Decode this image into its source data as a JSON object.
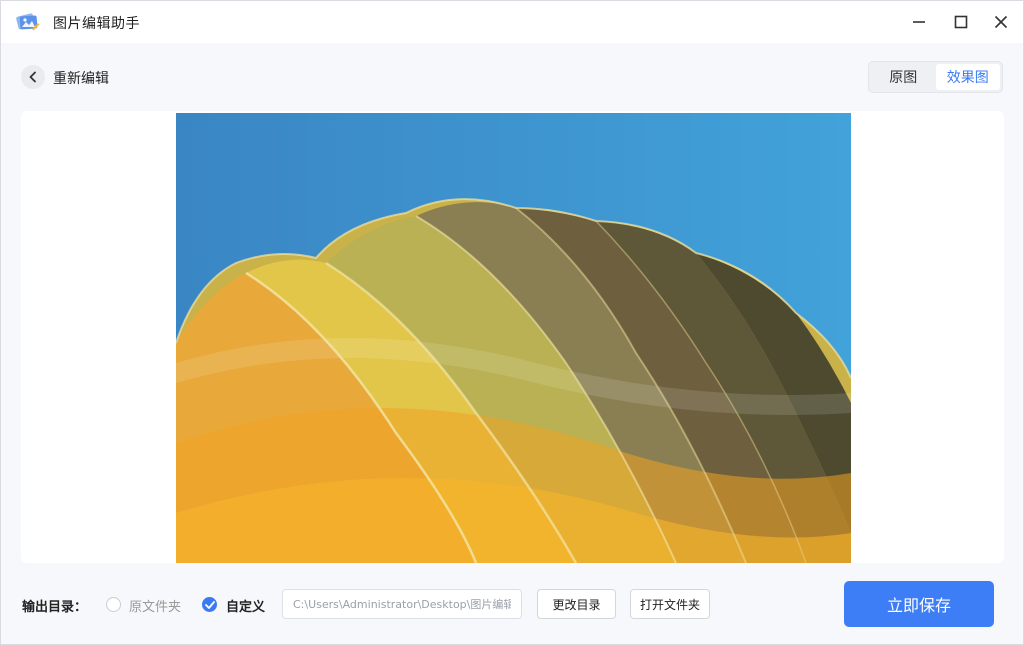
{
  "app": {
    "title": "图片编辑助手",
    "logo_icon": "photo-stack-icon",
    "window_controls": [
      "minimize-icon",
      "maximize-icon",
      "close-icon"
    ]
  },
  "toolbar": {
    "back_label": "重新编辑",
    "view_tabs": [
      {
        "label": "原图",
        "active": false
      },
      {
        "label": "效果图",
        "active": true
      }
    ]
  },
  "preview": {
    "image_subject": "hot-air-balloon-photo"
  },
  "output": {
    "label": "输出目录：",
    "option_original": "原文件夹",
    "option_custom": "自定义",
    "selected": "自定义",
    "path_value": "C:\\Users\\Administrator\\Desktop\\图片编辑",
    "change_dir_label": "更改目录",
    "open_folder_label": "打开文件夹",
    "save_label": "立即保存"
  },
  "colors": {
    "accent": "#3d7ef7",
    "sky": "#3b8fcf"
  }
}
